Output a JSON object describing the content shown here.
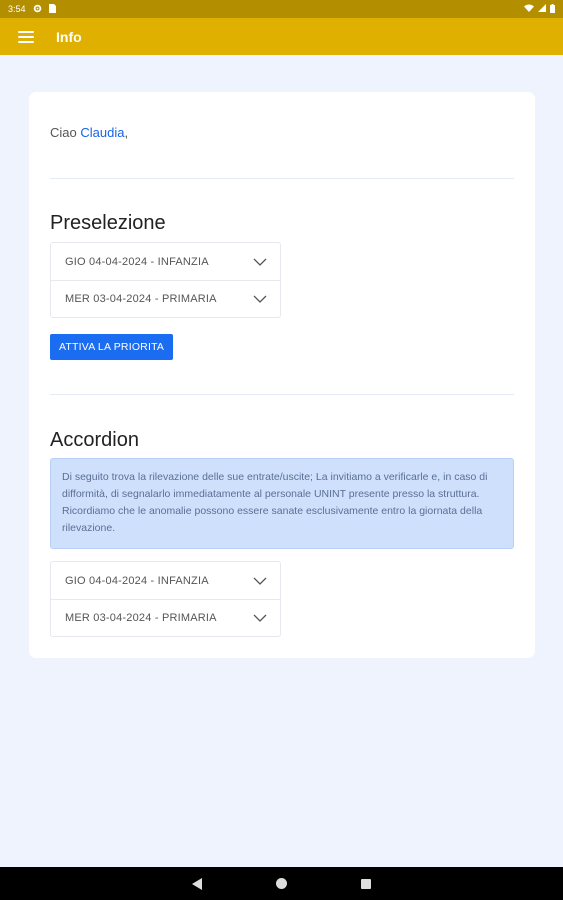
{
  "status_bar": {
    "time": "3:54",
    "icons": [
      "gear-icon",
      "sim-card-icon",
      "wifi-icon",
      "signal-icon",
      "battery-icon"
    ]
  },
  "app_bar": {
    "title": "Info",
    "menu_icon": "hamburger-menu-icon",
    "background": "#e0b000"
  },
  "greeting": {
    "prefix": "Ciao ",
    "name": "Claudia",
    "suffix": ","
  },
  "preselezione": {
    "title": "Preselezione",
    "items": [
      {
        "label": "GIO 04-04-2024 - INFANZIA"
      },
      {
        "label": "MER 03-04-2024 - PRIMARIA"
      }
    ],
    "button_label": "ATTIVA LA PRIORITA"
  },
  "accordion": {
    "title": "Accordion",
    "info_text": "Di seguito trova la rilevazione delle sue entrate/uscite; La invitiamo a verificarle e, in caso di difformità, di segnalarlo immediatamente al personale UNINT presente presso la struttura. Ricordiamo che le anomalie possono essere sanate esclusivamente entro la giornata della rilevazione.",
    "items": [
      {
        "label": "GIO 04-04-2024 - INFANZIA"
      },
      {
        "label": "MER 03-04-2024 - PRIMARIA"
      }
    ]
  },
  "colors": {
    "accent": "#1a6cf0",
    "status_bar": "#b38f00",
    "page_background": "#eef3fd",
    "info_background": "#cfe0fc"
  }
}
